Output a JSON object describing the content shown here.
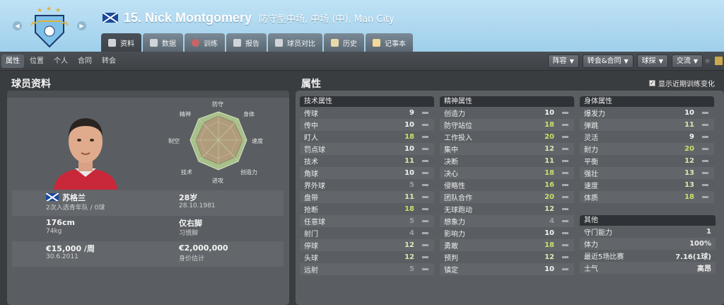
{
  "header": {
    "player_name": "15. Nick Montgomery",
    "subtitle": "防守型中场, 中场 (中), Man City",
    "tabs": [
      {
        "label": "资料",
        "icon": "profile-icon"
      },
      {
        "label": "数据",
        "icon": "stats-icon"
      },
      {
        "label": "训练",
        "icon": "training-icon"
      },
      {
        "label": "报告",
        "icon": "report-icon"
      },
      {
        "label": "球员对比",
        "icon": "compare-icon"
      },
      {
        "label": "历史",
        "icon": "history-icon"
      },
      {
        "label": "记事本",
        "icon": "notepad-icon"
      }
    ]
  },
  "subnav": [
    "属性",
    "位置",
    "个人",
    "合同",
    "转会"
  ],
  "actions": [
    "阵容",
    "转会&合同",
    "球探",
    "交流"
  ],
  "profile": {
    "title": "球员资料",
    "radar_labels": [
      "防守",
      "身体",
      "速度",
      "创造力",
      "进攻",
      "技术",
      "制空",
      "精神"
    ],
    "nationality": "苏格兰",
    "caps": "2次入选青年队 / 0球",
    "age": "28岁",
    "dob": "28.10.1981",
    "height": "176cm",
    "weight": "74kg",
    "foot": "仅右脚",
    "foot_label": "习惯脚",
    "wage": "€15,000 /周",
    "contract_end": "30.6.2011",
    "value": "€2,000,000",
    "value_label": "身价估计"
  },
  "attributes": {
    "title": "属性",
    "toggle_label": "显示近期训练变化",
    "technical": {
      "header": "技术属性",
      "rows": [
        {
          "name": "传球",
          "value": "9",
          "tone": "white"
        },
        {
          "name": "传中",
          "value": "10",
          "tone": "white"
        },
        {
          "name": "盯人",
          "value": "18",
          "tone": "green"
        },
        {
          "name": "罚点球",
          "value": "10",
          "tone": "white"
        },
        {
          "name": "技术",
          "value": "11",
          "tone": "light"
        },
        {
          "name": "角球",
          "value": "10",
          "tone": "white"
        },
        {
          "name": "界外球",
          "value": "5",
          "tone": "grey"
        },
        {
          "name": "盘带",
          "value": "11",
          "tone": "light"
        },
        {
          "name": "抢断",
          "value": "18",
          "tone": "green"
        },
        {
          "name": "任意球",
          "value": "5",
          "tone": "grey"
        },
        {
          "name": "射门",
          "value": "4",
          "tone": "grey"
        },
        {
          "name": "停球",
          "value": "12",
          "tone": "light"
        },
        {
          "name": "头球",
          "value": "12",
          "tone": "light"
        },
        {
          "name": "远射",
          "value": "5",
          "tone": "grey"
        }
      ]
    },
    "mental": {
      "header": "精神属性",
      "rows": [
        {
          "name": "创造力",
          "value": "10",
          "tone": "white"
        },
        {
          "name": "防守站位",
          "value": "18",
          "tone": "green"
        },
        {
          "name": "工作投入",
          "value": "20",
          "tone": "green"
        },
        {
          "name": "集中",
          "value": "12",
          "tone": "light"
        },
        {
          "name": "决断",
          "value": "11",
          "tone": "light"
        },
        {
          "name": "决心",
          "value": "18",
          "tone": "green"
        },
        {
          "name": "侵略性",
          "value": "16",
          "tone": "green"
        },
        {
          "name": "团队合作",
          "value": "20",
          "tone": "green"
        },
        {
          "name": "无球跑动",
          "value": "12",
          "tone": "light"
        },
        {
          "name": "想象力",
          "value": "4",
          "tone": "grey"
        },
        {
          "name": "影响力",
          "value": "10",
          "tone": "white"
        },
        {
          "name": "勇敢",
          "value": "18",
          "tone": "green"
        },
        {
          "name": "预判",
          "value": "12",
          "tone": "light"
        },
        {
          "name": "镇定",
          "value": "10",
          "tone": "white"
        }
      ]
    },
    "physical": {
      "header": "身体属性",
      "rows": [
        {
          "name": "爆发力",
          "value": "10",
          "tone": "white"
        },
        {
          "name": "弹跳",
          "value": "11",
          "tone": "light"
        },
        {
          "name": "灵活",
          "value": "9",
          "tone": "white"
        },
        {
          "name": "耐力",
          "value": "20",
          "tone": "green"
        },
        {
          "name": "平衡",
          "value": "12",
          "tone": "light"
        },
        {
          "name": "强壮",
          "value": "13",
          "tone": "light"
        },
        {
          "name": "速度",
          "value": "13",
          "tone": "light"
        },
        {
          "name": "体质",
          "value": "18",
          "tone": "green"
        }
      ]
    },
    "other": {
      "header": "其他",
      "rows": [
        {
          "name": "守门能力",
          "value": "1"
        },
        {
          "name": "体力",
          "value": "100%"
        },
        {
          "name": "最近5场比赛",
          "value": "7.16(1球)"
        },
        {
          "name": "士气",
          "value": "高昂"
        }
      ]
    }
  }
}
